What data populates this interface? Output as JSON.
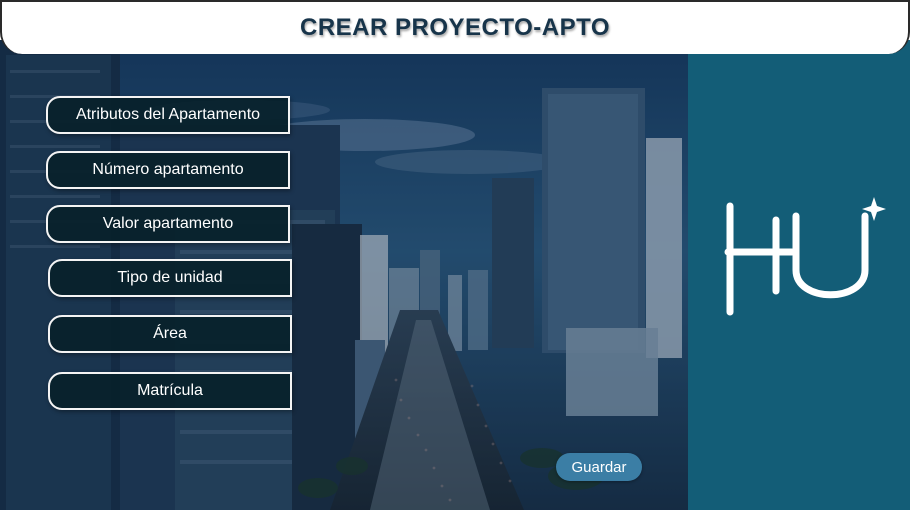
{
  "header": {
    "title": "CREAR PROYECTO-APTO"
  },
  "menu": {
    "items": [
      {
        "label": "Atributos del Apartamento"
      },
      {
        "label": "Número apartamento"
      },
      {
        "label": "Valor apartamento"
      },
      {
        "label": "Tipo de unidad"
      },
      {
        "label": "Área"
      },
      {
        "label": "Matrícula"
      }
    ]
  },
  "actions": {
    "save_label": "Guardar"
  },
  "colors": {
    "header_text": "#17344a",
    "panel": "#135d77",
    "button_fill": "#08212a",
    "button_border": "#f4f4f4",
    "save_button": "#3b7ea5"
  },
  "icons": {
    "logo": "hu-logo-icon",
    "background": "city-background-image"
  }
}
